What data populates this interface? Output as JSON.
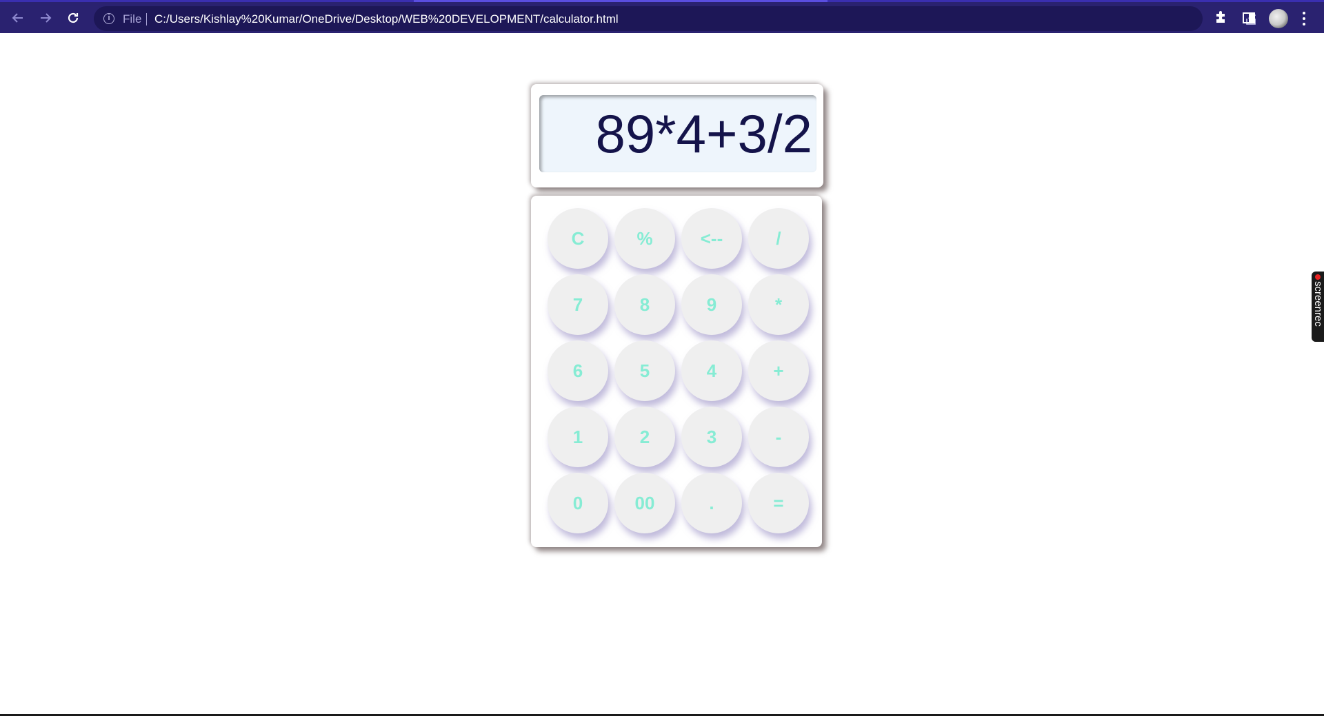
{
  "browser": {
    "file_label": "File",
    "url": "C:/Users/Kishlay%20Kumar/OneDrive/Desktop/WEB%20DEVELOPMENT/calculator.html"
  },
  "calculator": {
    "display": "89*4+3/2",
    "keys": [
      [
        "C",
        "%",
        "<--",
        "/"
      ],
      [
        "7",
        "8",
        "9",
        "*"
      ],
      [
        "6",
        "5",
        "4",
        "+"
      ],
      [
        "1",
        "2",
        "3",
        "-"
      ],
      [
        "0",
        "00",
        ".",
        "="
      ]
    ]
  },
  "screenrec": {
    "label": "screenrec"
  },
  "colors": {
    "chrome_bg": "#2a2270",
    "omnibox_bg": "#1d1757",
    "display_text": "#14134a",
    "display_bg": "#eef5fc",
    "key_bg": "#efefef",
    "key_text": "#86ecd4"
  }
}
